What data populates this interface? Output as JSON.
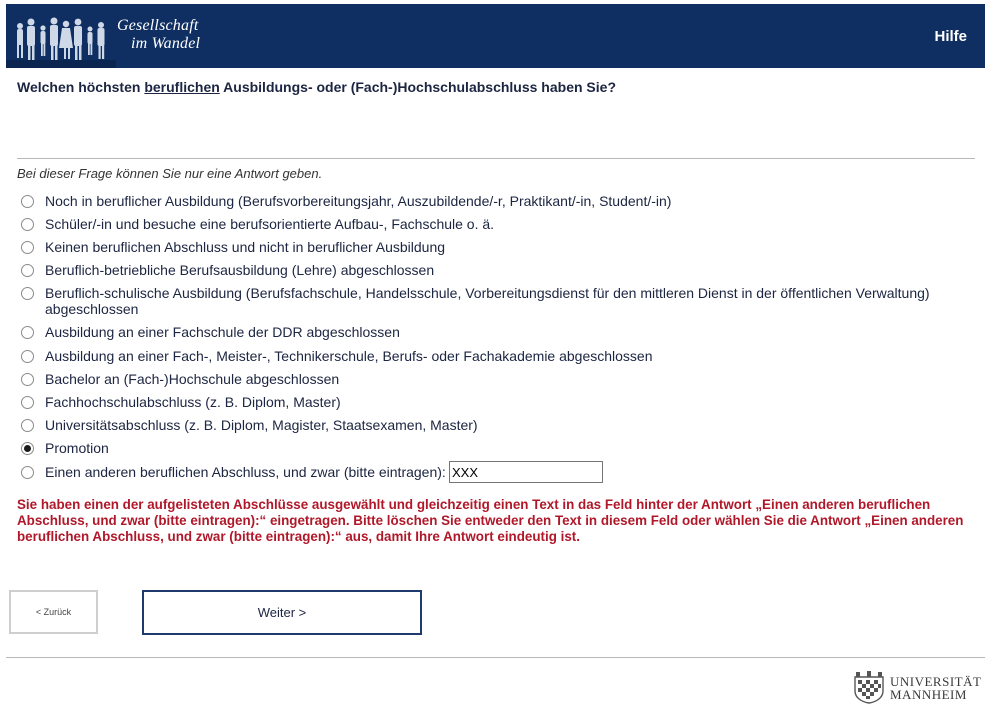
{
  "header": {
    "logo_line1": "Gesellschaft",
    "logo_line2": "im Wandel",
    "help_label": "Hilfe",
    "color": "#0f2f62"
  },
  "question": {
    "before": "Welchen höchsten ",
    "underlined": "beruflichen",
    "after": " Ausbildungs- oder (Fach-)Hochschulabschluss haben Sie?"
  },
  "hint": "Bei dieser Frage können Sie nur eine Antwort geben.",
  "options": [
    {
      "label": "Noch in beruflicher Ausbildung (Berufsvorbereitungsjahr, Auszubildende/-r, Praktikant/-in, Student/-in)",
      "checked": false
    },
    {
      "label": "Schüler/-in und besuche eine berufsorientierte Aufbau-, Fachschule o. ä.",
      "checked": false
    },
    {
      "label": "Keinen beruflichen Abschluss und nicht in beruflicher Ausbildung",
      "checked": false
    },
    {
      "label": "Beruflich-betriebliche Berufsausbildung (Lehre) abgeschlossen",
      "checked": false
    },
    {
      "label": "Beruflich-schulische Ausbildung (Berufsfachschule, Handelsschule, Vorbereitungsdienst für den mittleren Dienst in der öffentlichen Verwaltung) abgeschlossen",
      "checked": false
    },
    {
      "label": "Ausbildung an einer Fachschule der DDR abgeschlossen",
      "checked": false
    },
    {
      "label": "Ausbildung an einer Fach-, Meister-, Technikerschule, Berufs- oder Fachakademie abgeschlossen",
      "checked": false
    },
    {
      "label": "Bachelor an (Fach-)Hochschule abgeschlossen",
      "checked": false
    },
    {
      "label": "Fachhochschulabschluss (z. B. Diplom, Master)",
      "checked": false
    },
    {
      "label": "Universitätsabschluss (z. B. Diplom, Magister, Staatsexamen, Master)",
      "checked": false
    },
    {
      "label": "Promotion",
      "checked": true
    },
    {
      "label": "Einen anderen beruflichen Abschluss, und zwar (bitte eintragen):",
      "checked": false
    }
  ],
  "other_input_value": "XXX",
  "error": "Sie haben einen der aufgelisteten Abschlüsse ausgewählt und gleichzeitig einen Text in das Feld hinter der Antwort „Einen anderen beruflichen Abschluss, und zwar (bitte eintragen):“ eingetragen. Bitte löschen Sie entweder den Text in diesem Feld oder wählen Sie die Antwort „Einen anderen beruflichen Abschluss, und zwar (bitte eintragen):“ aus, damit Ihre Antwort eindeutig ist.",
  "nav": {
    "back_label": "< Zurück",
    "next_label": "Weiter >"
  },
  "footer": {
    "uni_line1": "UNIVERSITÄT",
    "uni_line2": "MANNHEIM"
  }
}
